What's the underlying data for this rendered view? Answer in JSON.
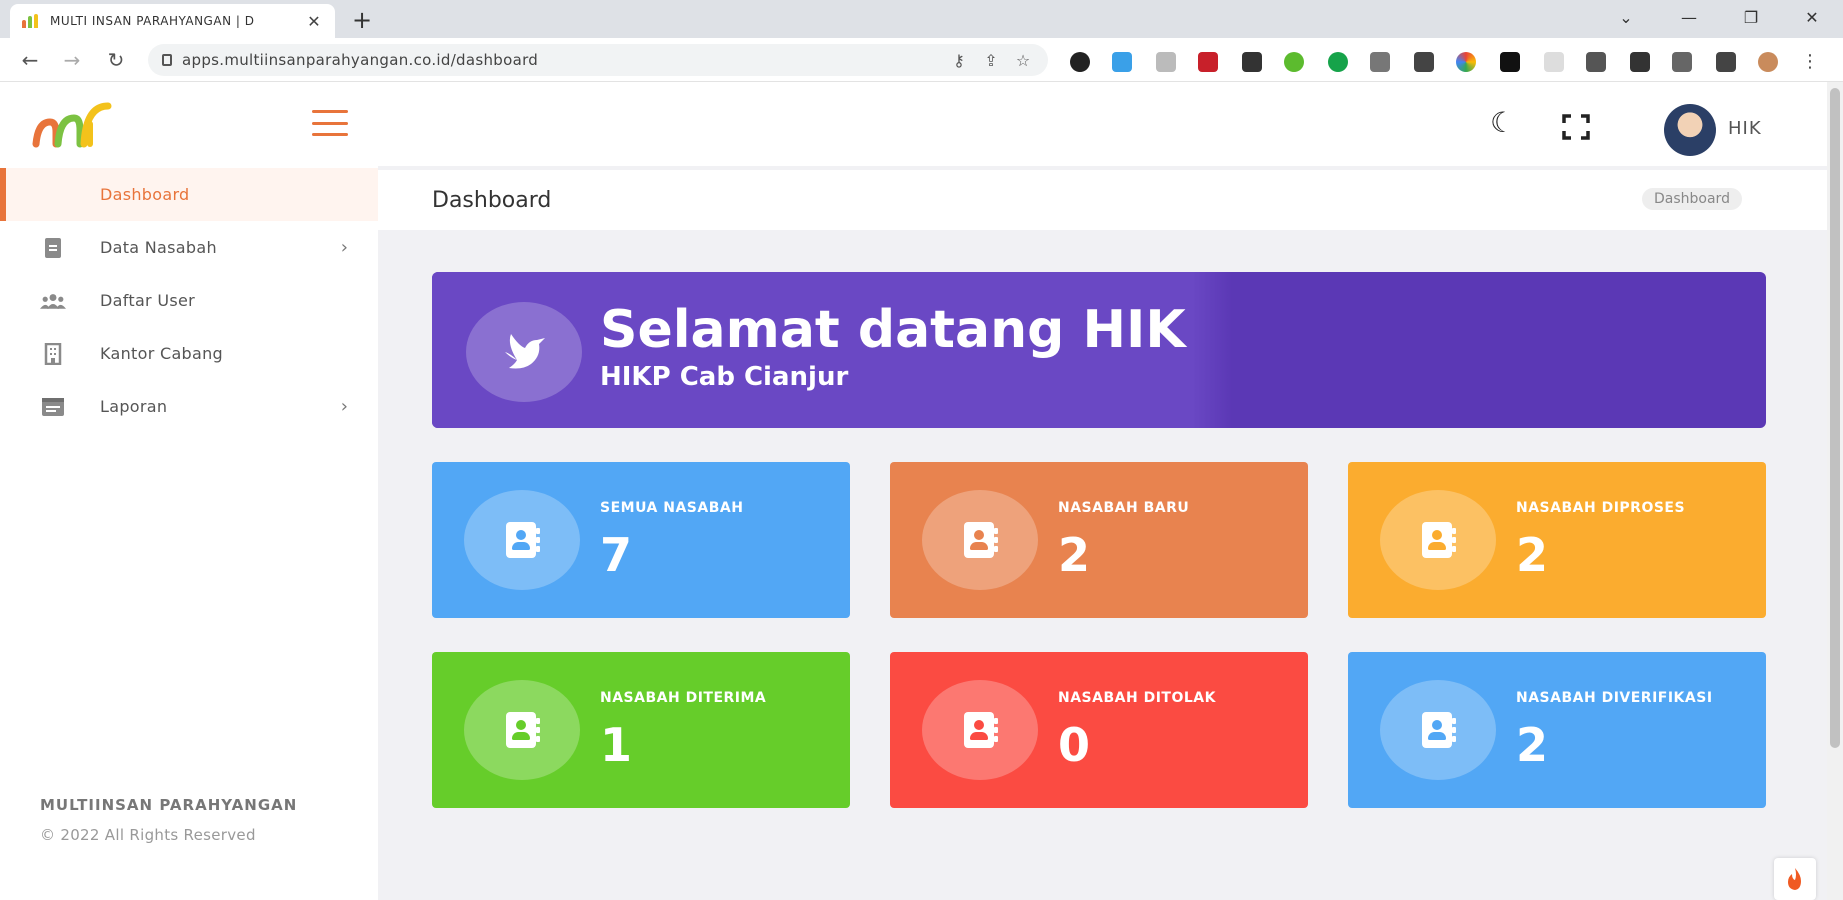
{
  "browser": {
    "tab_title": "MULTI INSAN PARAHYANGAN | D",
    "tab_close": "✕",
    "new_tab": "+",
    "url": "apps.multiinsanparahyangan.co.id/dashboard",
    "window_controls": [
      "⌄",
      "—",
      "❐",
      "✕"
    ]
  },
  "sidebar": {
    "menu": [
      {
        "label": "Dashboard",
        "icon": "home-icon",
        "active": true,
        "has_chevron": false
      },
      {
        "label": "Data Nasabah",
        "icon": "document-icon",
        "active": false,
        "has_chevron": true
      },
      {
        "label": "Daftar User",
        "icon": "users-icon",
        "active": false,
        "has_chevron": false
      },
      {
        "label": "Kantor Cabang",
        "icon": "building-icon",
        "active": false,
        "has_chevron": false
      },
      {
        "label": "Laporan",
        "icon": "report-icon",
        "active": false,
        "has_chevron": true
      }
    ],
    "chevron": "›",
    "footer_brand": "MULTIINSAN PARAHYANGAN",
    "footer_copy": "© 2022 All Rights Reserved"
  },
  "topbar": {
    "username": "HIK"
  },
  "page": {
    "title": "Dashboard",
    "breadcrumb": "Dashboard"
  },
  "welcome": {
    "title": "Selamat datang HIK",
    "subtitle": "HIKP Cab Cianjur"
  },
  "cards": [
    {
      "label": "SEMUA NASABAH",
      "value": "7",
      "color": "#52a7f5"
    },
    {
      "label": "NASABAH BARU",
      "value": "2",
      "color": "#e8834f"
    },
    {
      "label": "NASABAH DIPROSES",
      "value": "2",
      "color": "#fbac2f"
    },
    {
      "label": "NASABAH DITERIMA",
      "value": "1",
      "color": "#66cd2a"
    },
    {
      "label": "NASABAH DITOLAK",
      "value": "0",
      "color": "#fb4b42"
    },
    {
      "label": "NASABAH DIVERIFIKASI",
      "value": "2",
      "color": "#52a7f5"
    }
  ],
  "colors": {
    "accent": "#e8743b",
    "welcome": "#5b38b5"
  }
}
